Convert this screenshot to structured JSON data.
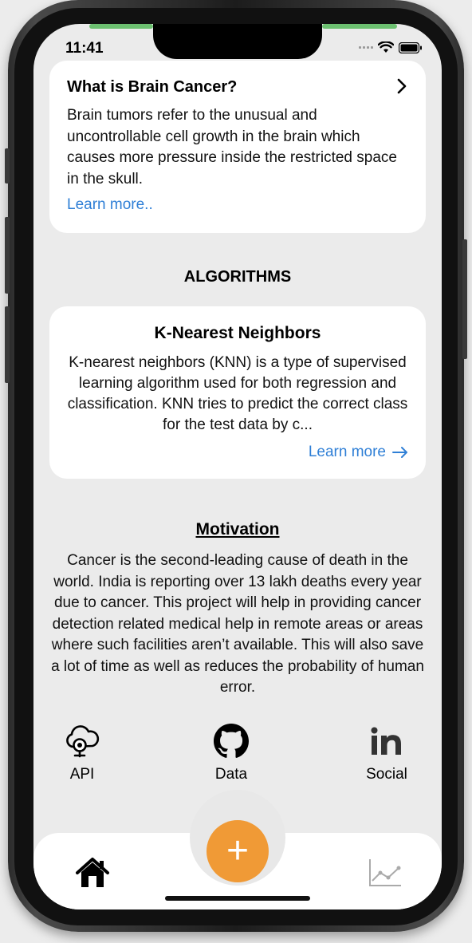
{
  "status_bar": {
    "time": "11:41"
  },
  "info_card": {
    "title": "What is Brain Cancer?",
    "body": "Brain tumors refer to the unusual and uncontrollable cell growth in the brain which causes more pressure inside the restricted space in the skull.",
    "link": "Learn more.."
  },
  "algorithms": {
    "section_title": "ALGORITHMS",
    "card": {
      "title": "K-Nearest Neighbors",
      "body": "K-nearest neighbors (KNN) is a type of supervised learning algorithm used for both regression and classification. KNN tries to predict the correct class for the test data by c...",
      "link": "Learn more"
    }
  },
  "motivation": {
    "title": "Motivation",
    "body": "Cancer is the second-leading cause of death in the world. India is reporting over 13 lakh deaths every year due to cancer. This project will help in providing cancer detection related medical help in remote areas or areas where such facilities aren’t available. This will also save a lot of time as well as reduces the probability of human error."
  },
  "links": [
    {
      "label": "API",
      "icon": "cloud-api-icon"
    },
    {
      "label": "Data",
      "icon": "github-icon"
    },
    {
      "label": "Social",
      "icon": "linkedin-icon"
    }
  ],
  "tab_bar": {
    "home_icon": "home-icon",
    "fab_symbol": "+",
    "chart_icon": "chart-icon"
  },
  "colors": {
    "accent": "#f09a36",
    "link": "#2f7fd6",
    "background": "#ebebeb"
  }
}
